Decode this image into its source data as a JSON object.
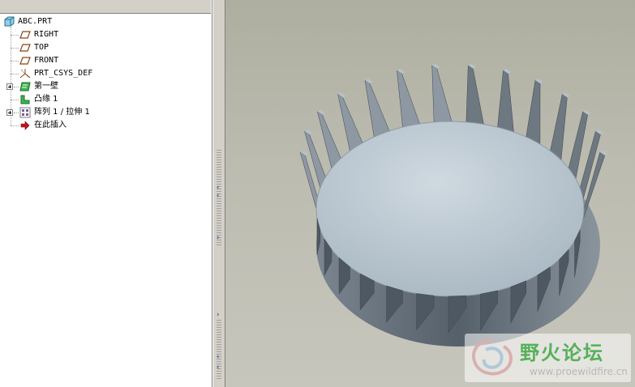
{
  "model_tree": {
    "items": [
      {
        "label": "ABC.PRT",
        "icon": "part-icon"
      },
      {
        "label": "RIGHT",
        "icon": "datum-plane-icon"
      },
      {
        "label": "TOP",
        "icon": "datum-plane-icon"
      },
      {
        "label": "FRONT",
        "icon": "datum-plane-icon"
      },
      {
        "label": "PRT_CSYS_DEF",
        "icon": "coordinate-system-icon"
      },
      {
        "label": "第一壁",
        "icon": "sheetmetal-wall-icon"
      },
      {
        "label": "凸缘 1",
        "icon": "flange-wall-icon"
      },
      {
        "label": "阵列 1 / 拉伸 1",
        "icon": "pattern-icon"
      },
      {
        "label": "在此插入",
        "icon": "insert-here-arrow-icon"
      }
    ]
  },
  "watermark": {
    "title": "野火论坛",
    "url": "www.proewildfire.cn"
  },
  "colors": {
    "graphics_background": "#bdbcb1",
    "model_inner_face": "#c0cdd6",
    "model_wall": "#5d6670",
    "model_top_face": "#8c98a3",
    "tree_background": "#ffffff"
  }
}
